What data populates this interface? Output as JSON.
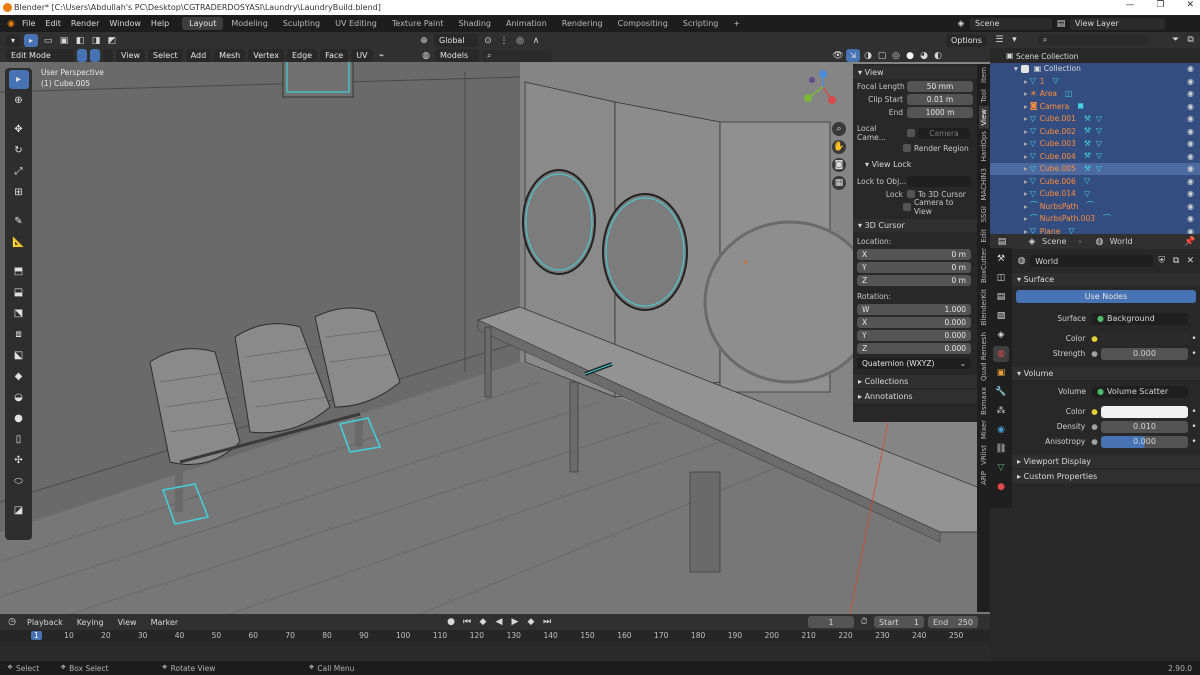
{
  "window": {
    "title": "Blender* [C:\\Users\\Abdullah's PC\\Desktop\\CGTRADERDOSYASI\\Laundry\\LaundryBuild.blend]",
    "controls": [
      "—",
      "❐",
      "✕"
    ]
  },
  "menu": [
    "File",
    "Edit",
    "Render",
    "Window",
    "Help"
  ],
  "workspaces": [
    {
      "label": "Layout",
      "active": true
    },
    {
      "label": "Modeling"
    },
    {
      "label": "Sculpting"
    },
    {
      "label": "UV Editing"
    },
    {
      "label": "Texture Paint"
    },
    {
      "label": "Shading"
    },
    {
      "label": "Animation"
    },
    {
      "label": "Rendering"
    },
    {
      "label": "Compositing"
    },
    {
      "label": "Scripting"
    }
  ],
  "scene_field": "Scene",
  "view_layer_field": "View Layer",
  "viewport_header": {
    "mode": "Edit Mode",
    "menus": [
      "View",
      "Select",
      "Add",
      "Mesh",
      "Vertex",
      "Edge",
      "Face",
      "UV"
    ],
    "orientation": "Global",
    "models_field": "Models",
    "options": "Options"
  },
  "viewport": {
    "perspective": "User Perspective",
    "object": "(1) Cube.005"
  },
  "npanel": {
    "view_header": "View",
    "focal_length_label": "Focal Length",
    "focal_length": "50 mm",
    "clip_start_label": "Clip Start",
    "clip_start": "0.01 m",
    "end_label": "End",
    "end": "1000 m",
    "local_camera_label": "Local Came...",
    "camera_field": "Camera",
    "render_region": "Render Region",
    "view_lock_header": "View Lock",
    "lock_to_obj_label": "Lock to Obj...",
    "lock_label": "Lock",
    "to_3d_cursor": "To 3D Cursor",
    "camera_to_view": "Camera to View",
    "cursor_header": "3D Cursor",
    "location_label": "Location:",
    "loc": [
      {
        "axis": "X",
        "value": "0 m"
      },
      {
        "axis": "Y",
        "value": "0 m"
      },
      {
        "axis": "Z",
        "value": "0 m"
      }
    ],
    "rotation_label": "Rotation:",
    "rot": [
      {
        "axis": "W",
        "value": "1.000"
      },
      {
        "axis": "X",
        "value": "0.000"
      },
      {
        "axis": "Y",
        "value": "0.000"
      },
      {
        "axis": "Z",
        "value": "0.000"
      }
    ],
    "rotation_mode": "Quaternion (WXYZ)",
    "collections_header": "Collections",
    "annotations_header": "Annotations"
  },
  "ntabs": [
    "Item",
    "Tool",
    "View",
    "HardOps",
    "MACHIN3",
    "SSGI",
    "Edit",
    "BoxCutter",
    "BlenderKit",
    "Quad Remesh",
    "Bsmaxx",
    "Mixer",
    "VRlist",
    "ARP"
  ],
  "outliner": {
    "search_placeholder": "",
    "root": "Scene Collection",
    "collection": "Collection",
    "items": [
      {
        "name": "1",
        "icon": "mesh-icon"
      },
      {
        "name": "Area",
        "icon": "light-icon"
      },
      {
        "name": "Camera",
        "icon": "camera-icon"
      },
      {
        "name": "Cube.001",
        "icon": "mesh-icon"
      },
      {
        "name": "Cube.002",
        "icon": "mesh-icon"
      },
      {
        "name": "Cube.003",
        "icon": "mesh-icon"
      },
      {
        "name": "Cube.004",
        "icon": "mesh-icon"
      },
      {
        "name": "Cube.005",
        "icon": "mesh-icon",
        "active": true
      },
      {
        "name": "Cube.006",
        "icon": "mesh-icon"
      },
      {
        "name": "Cube.014",
        "icon": "mesh-icon"
      },
      {
        "name": "NurbsPath",
        "icon": "curve-icon"
      },
      {
        "name": "NurbsPath.003",
        "icon": "curve-icon"
      },
      {
        "name": "Plane",
        "icon": "mesh-icon"
      }
    ]
  },
  "properties": {
    "breadcrumb_scene": "Scene",
    "breadcrumb_world": "World",
    "world_field": "World",
    "surface_header": "Surface",
    "use_nodes": "Use Nodes",
    "surface_label": "Surface",
    "surface_value": "Background",
    "color_label": "Color",
    "strength_label": "Strength",
    "strength_value": "0.000",
    "volume_header": "Volume",
    "volume_label": "Volume",
    "volume_value": "Volume Scatter",
    "vcolor_label": "Color",
    "density_label": "Density",
    "density_value": "0.010",
    "anisotropy_label": "Anisotropy",
    "anisotropy_value": "0.000",
    "viewport_display": "Viewport Display",
    "custom_properties": "Custom Properties"
  },
  "timeline": {
    "menus": [
      "Playback",
      "Keying",
      "View",
      "Marker"
    ],
    "current_frame": "1",
    "start_label": "Start",
    "start": "1",
    "end_label": "End",
    "end": "250",
    "ticks": [
      "1",
      "10",
      "20",
      "30",
      "40",
      "50",
      "60",
      "70",
      "80",
      "90",
      "100",
      "110",
      "120",
      "130",
      "140",
      "150",
      "160",
      "170",
      "180",
      "190",
      "200",
      "210",
      "220",
      "230",
      "240",
      "250"
    ]
  },
  "status": {
    "select": "Select",
    "box_select": "Box Select",
    "rotate_view": "Rotate View",
    "call_menu": "Call Menu",
    "version": "2.90.0"
  },
  "colors": {
    "accent": "#4772b3",
    "selected_row": "#334d80",
    "edit_highlight": "#41d1de",
    "object_name": "#ff8d3b"
  }
}
